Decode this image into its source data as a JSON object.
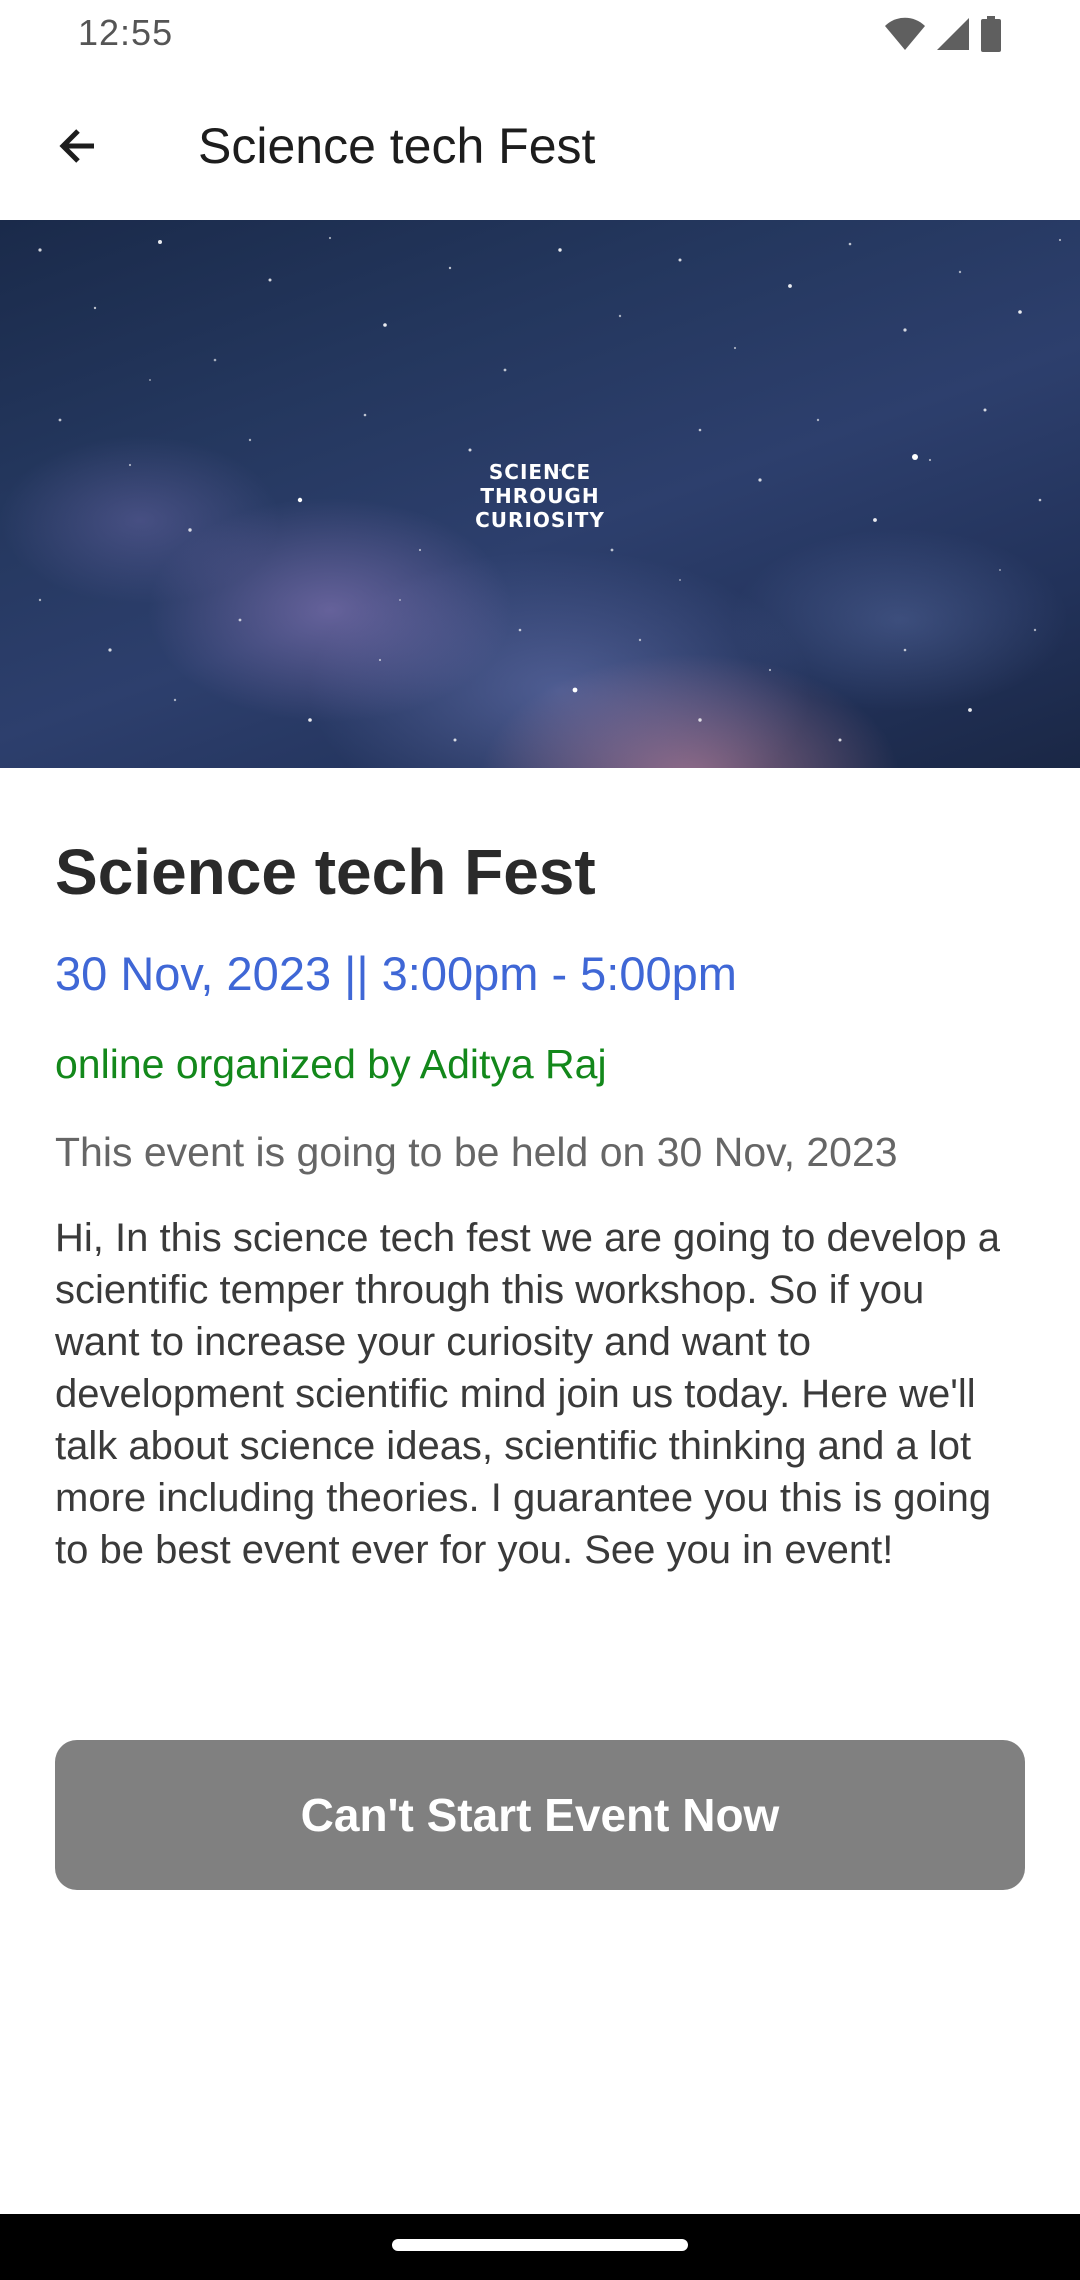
{
  "status_bar": {
    "time": "12:55",
    "icons": [
      "wifi-icon",
      "cellular-signal-icon",
      "battery-icon"
    ]
  },
  "app_bar": {
    "back_icon": "arrow-left-icon",
    "title": "Science tech Fest"
  },
  "banner": {
    "logo_text": "SCIENCE\nTHROUGH\nCURIOSITY"
  },
  "event": {
    "title": "Science tech Fest",
    "datetime": "30 Nov, 2023 || 3:00pm - 5:00pm",
    "organizer": "online organized by Aditya Raj",
    "note": "This event is going to be held on 30 Nov, 2023",
    "description": "Hi, In this science tech fest we are going to develop a scientific temper through this workshop. So if you want to increase your curiosity and want to development scientific mind join us today. Here we'll talk about science ideas, scientific thinking and a lot more including theories. I guarantee you this is going to be best event ever for you. See you in event!"
  },
  "actions": {
    "start_button_label": "Can't Start Event Now"
  },
  "colors": {
    "datetime": "#3f67d6",
    "organizer": "#13881b",
    "button_disabled": "#808080"
  }
}
